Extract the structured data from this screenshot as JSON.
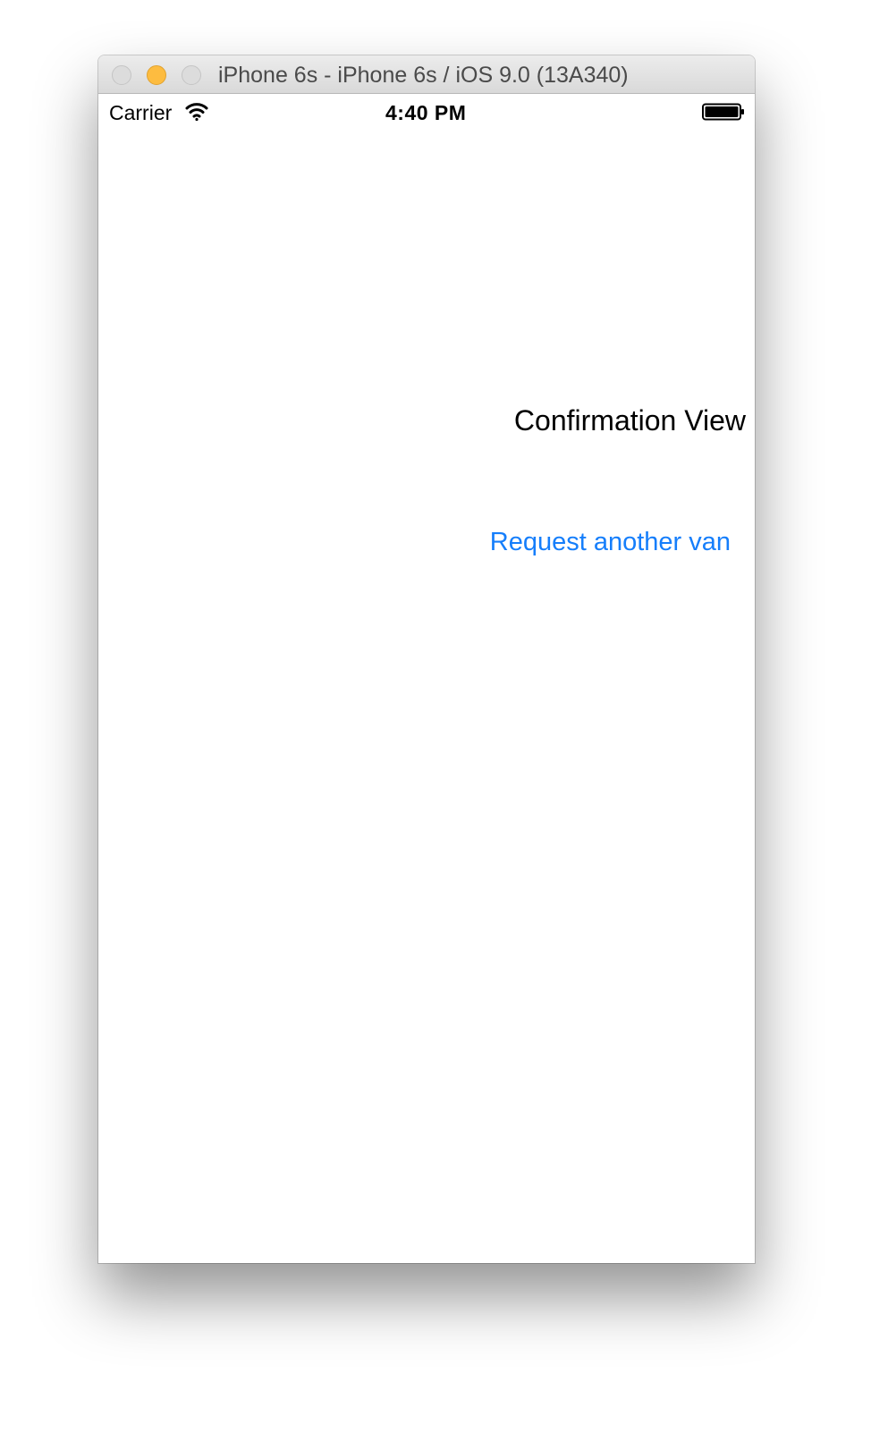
{
  "window": {
    "title": "iPhone 6s - iPhone 6s / iOS 9.0 (13A340)",
    "controls": {
      "close_icon": "close-icon",
      "minimize_icon": "minimize-icon",
      "zoom_icon": "zoom-icon"
    }
  },
  "status_bar": {
    "carrier": "Carrier",
    "signal_icon": "wifi-icon",
    "time": "4:40 PM",
    "battery_icon": "battery-icon"
  },
  "screen": {
    "label": "Confirmation View",
    "button_label": "Request another van"
  },
  "colors": {
    "accent": "#157efb",
    "minimize_button": "#fdbc40"
  }
}
